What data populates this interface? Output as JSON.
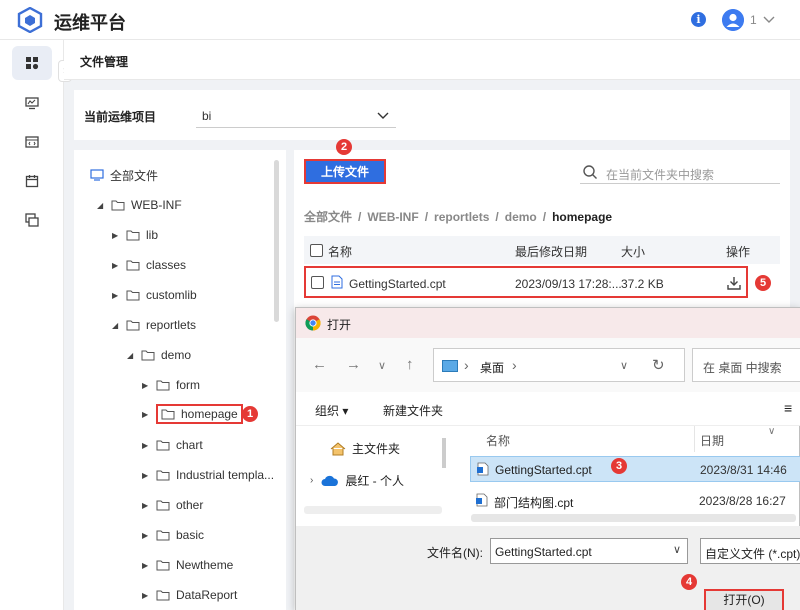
{
  "app": {
    "title": "运维平台",
    "user": "1"
  },
  "page": {
    "breadcrumb": "文件管理"
  },
  "project": {
    "label": "当前运维项目",
    "value": "bi"
  },
  "tree": {
    "root": "全部文件",
    "items": [
      "WEB-INF",
      "lib",
      "classes",
      "customlib",
      "reportlets",
      "demo",
      "form",
      "homepage",
      "chart",
      "Industrial templa...",
      "other",
      "basic",
      "Newtheme",
      "DataReport"
    ]
  },
  "files": {
    "upload_label": "上传文件",
    "search_placeholder": "在当前文件夹中搜索",
    "path": [
      "全部文件",
      "WEB-INF",
      "reportlets",
      "demo",
      "homepage"
    ],
    "path_sep": "/",
    "columns": {
      "name": "名称",
      "modified": "最后修改日期",
      "size": "大小",
      "action": "操作"
    },
    "rows": [
      {
        "name": "GettingStarted.cpt",
        "modified": "2023/09/13 17:28:...",
        "size": "37.2 KB"
      }
    ]
  },
  "dialog": {
    "title": "打开",
    "address": "桌面",
    "address_sep": "›",
    "search_placeholder": "在 桌面 中搜索",
    "organize": "组织",
    "new_folder": "新建文件夹",
    "sidebar": [
      "主文件夹",
      "晨红 - 个人"
    ],
    "columns": {
      "name": "名称",
      "date": "日期"
    },
    "files": [
      {
        "name": "GettingStarted.cpt",
        "date": "2023/8/31 14:46"
      },
      {
        "name": "部门结构图.cpt",
        "date": "2023/8/28 16:27"
      }
    ],
    "filename_label": "文件名(N):",
    "filename_value": "GettingStarted.cpt",
    "filetype": "自定义文件 (*.cpt)",
    "open_label": "打开(O)"
  },
  "steps": [
    "1",
    "2",
    "3",
    "4",
    "5"
  ],
  "colors": {
    "accent": "#2f6ee0",
    "highlight": "#e53935",
    "selected": "#cce4f7"
  }
}
